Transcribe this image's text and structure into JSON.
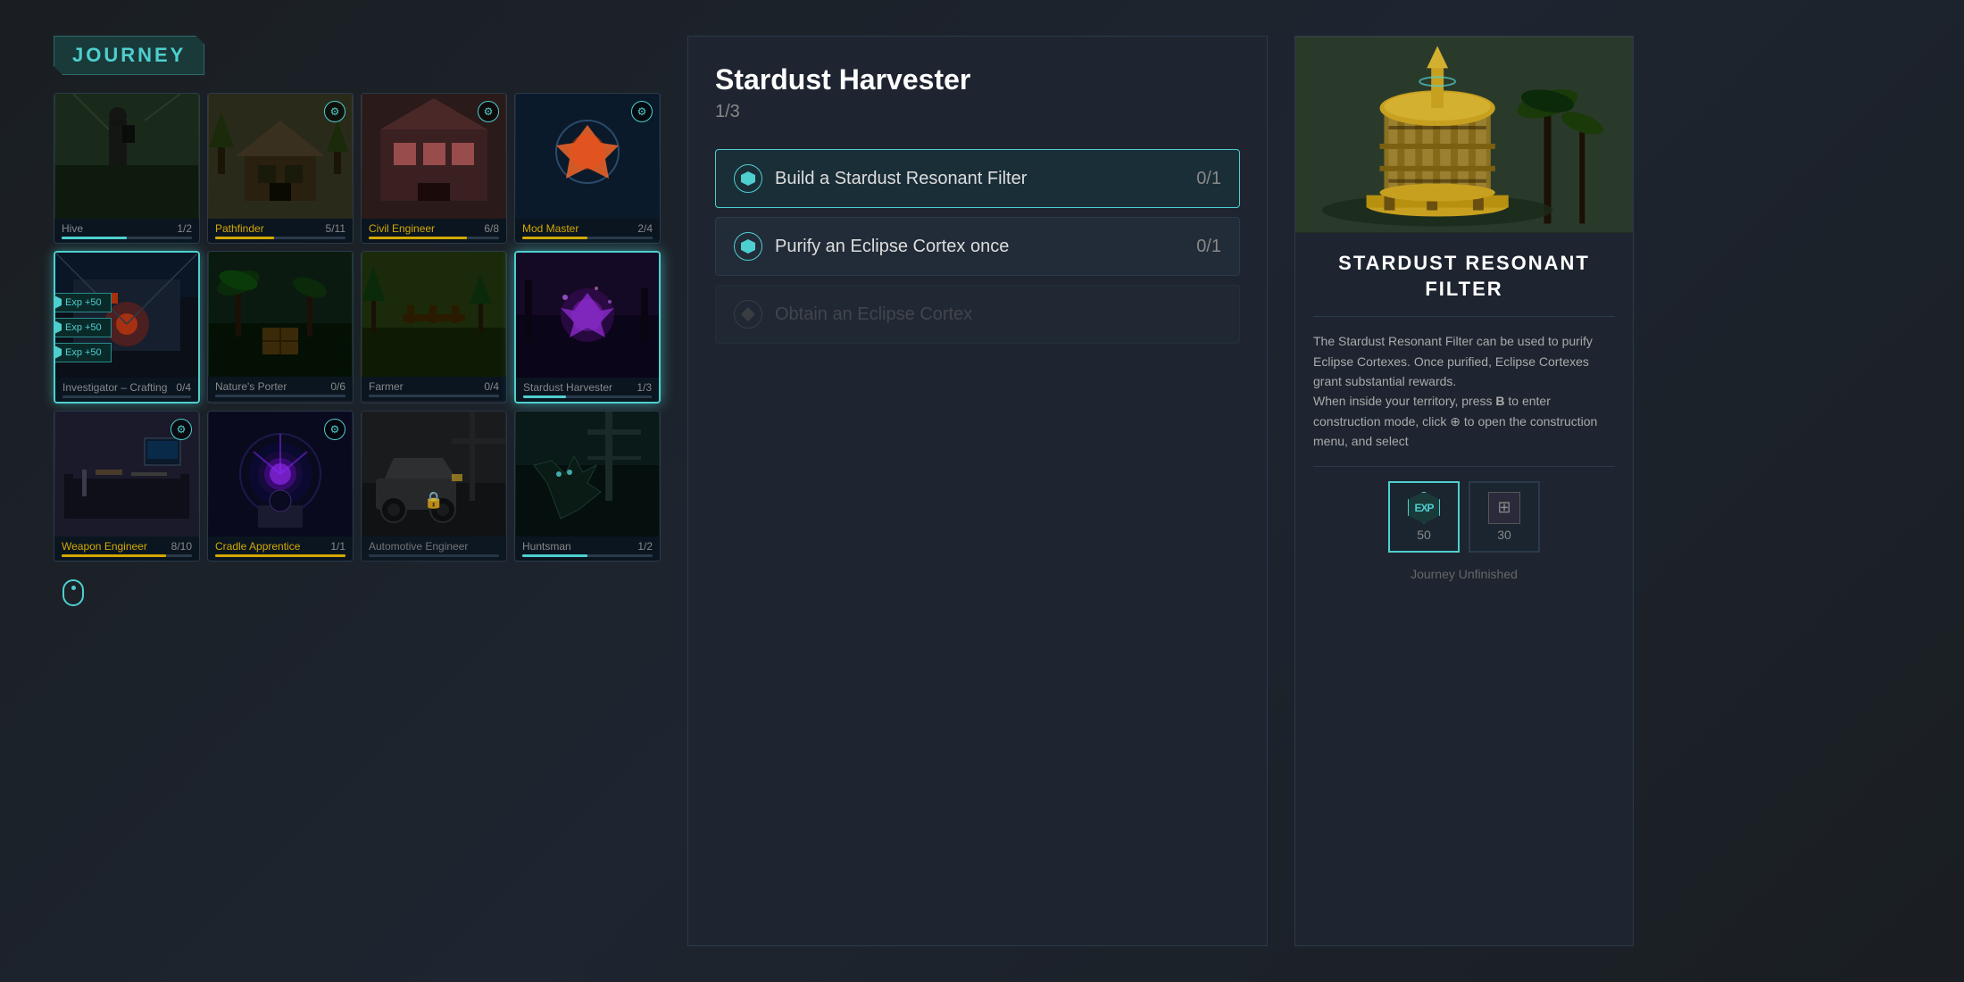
{
  "page": {
    "title": "JOURNEY"
  },
  "grid": {
    "cards": [
      {
        "id": "hive",
        "label": "Hive",
        "labelColor": "white",
        "progress": "1/2",
        "progressPct": 50,
        "progressColor": "teal",
        "hasIcon": false,
        "row": 1
      },
      {
        "id": "pathfinder",
        "label": "Pathfinder",
        "labelColor": "gold",
        "progress": "5/11",
        "progressPct": 45,
        "progressColor": "gold",
        "hasIcon": true,
        "row": 1
      },
      {
        "id": "civil-engineer",
        "label": "Civil Engineer",
        "labelColor": "gold",
        "progress": "6/8",
        "progressPct": 75,
        "progressColor": "gold",
        "hasIcon": true,
        "row": 1
      },
      {
        "id": "mod-master",
        "label": "Mod Master",
        "labelColor": "gold",
        "progress": "2/4",
        "progressPct": 50,
        "progressColor": "gold",
        "hasIcon": true,
        "row": 1
      },
      {
        "id": "investigator-crafting",
        "label": "Investigator – Crafting",
        "labelColor": "white",
        "progress": "0/4",
        "progressPct": 0,
        "progressColor": "teal",
        "hasIcon": false,
        "isActive": true,
        "row": 2
      },
      {
        "id": "natures-porter",
        "label": "Nature's Porter",
        "labelColor": "white",
        "progress": "0/6",
        "progressPct": 0,
        "progressColor": "teal",
        "hasIcon": false,
        "row": 2
      },
      {
        "id": "farmer",
        "label": "Farmer",
        "labelColor": "white",
        "progress": "0/4",
        "progressPct": 0,
        "progressColor": "teal",
        "hasIcon": false,
        "row": 2
      },
      {
        "id": "stardust-harvester",
        "label": "Stardust Harvester",
        "labelColor": "white",
        "progress": "1/3",
        "progressPct": 33,
        "progressColor": "teal",
        "hasIcon": false,
        "isHighlighted": true,
        "row": 2
      },
      {
        "id": "weapon-engineer",
        "label": "Weapon Engineer",
        "labelColor": "gold",
        "progress": "8/10",
        "progressPct": 80,
        "progressColor": "gold",
        "hasIcon": true,
        "row": 3
      },
      {
        "id": "cradle-apprentice",
        "label": "Cradle Apprentice",
        "labelColor": "gold",
        "progress": "1/1",
        "progressPct": 100,
        "progressColor": "gold",
        "hasIcon": true,
        "row": 3
      },
      {
        "id": "automotive-engineer",
        "label": "Automotive Engineer",
        "labelColor": "white",
        "progress": "",
        "progressPct": 0,
        "progressColor": "teal",
        "hasIcon": false,
        "isLocked": true,
        "row": 3
      },
      {
        "id": "huntsman",
        "label": "Huntsman",
        "labelColor": "white",
        "progress": "1/2",
        "progressPct": 50,
        "progressColor": "teal",
        "hasIcon": false,
        "row": 3
      }
    ],
    "expBadges": [
      "Exp +50",
      "Exp +50",
      "Exp +50"
    ]
  },
  "questPanel": {
    "title": "Stardust Harvester",
    "progress": "1/3",
    "quests": [
      {
        "id": "build-filter",
        "text": "Build a Stardust Resonant Filter",
        "count": "0/1",
        "isActive": true,
        "isLocked": false
      },
      {
        "id": "purify-cortex",
        "text": "Purify an Eclipse Cortex once",
        "count": "0/1",
        "isActive": false,
        "isLocked": false
      },
      {
        "id": "obtain-cortex",
        "text": "Obtain an Eclipse Cortex",
        "count": "",
        "isActive": false,
        "isLocked": true
      }
    ]
  },
  "itemPanel": {
    "name": "STARDUST RESONANT FILTER",
    "description": "The Stardust Resonant Filter can be used to purify Eclipse Cortexes. Once purified, Eclipse Cortexes grant substantial rewards.\nWhen inside your territory, press B to enter construction mode, click   to open the construction menu, and select",
    "rewards": [
      {
        "id": "exp-reward",
        "type": "exp",
        "amount": "50",
        "isActive": true
      },
      {
        "id": "blueprint-reward",
        "type": "blueprint",
        "amount": "30",
        "isActive": false
      }
    ],
    "status": "Journey Unfinished"
  }
}
